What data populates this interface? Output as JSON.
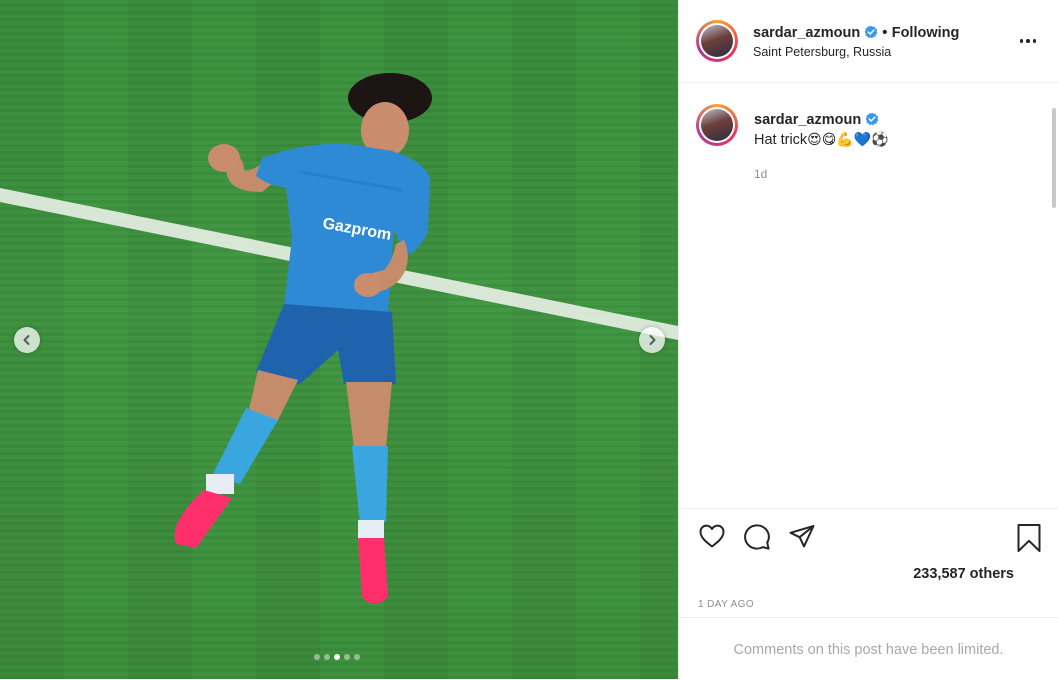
{
  "post": {
    "username": "sardar_azmoun",
    "follow_separator": "•",
    "follow_status": "Following",
    "location": "Saint Petersburg, Russia",
    "more_icon": "more-horizontal-icon"
  },
  "caption": {
    "username": "sardar_azmoun",
    "text": "Hat trick",
    "emojis": [
      "😍",
      "😋",
      "💪",
      "💙",
      "⚽"
    ],
    "time_short": "1d"
  },
  "carousel": {
    "total_slides": 5,
    "active_slide": 3
  },
  "actions": {
    "likes_text": "233,587 others",
    "date_text": "1 DAY AGO"
  },
  "comments": {
    "limited_notice": "Comments on this post have been limited."
  },
  "colors": {
    "verified": "#3897f0",
    "jersey": "#2f8ad6",
    "grass": "#3f9640",
    "boots": "#ff2f6b"
  }
}
